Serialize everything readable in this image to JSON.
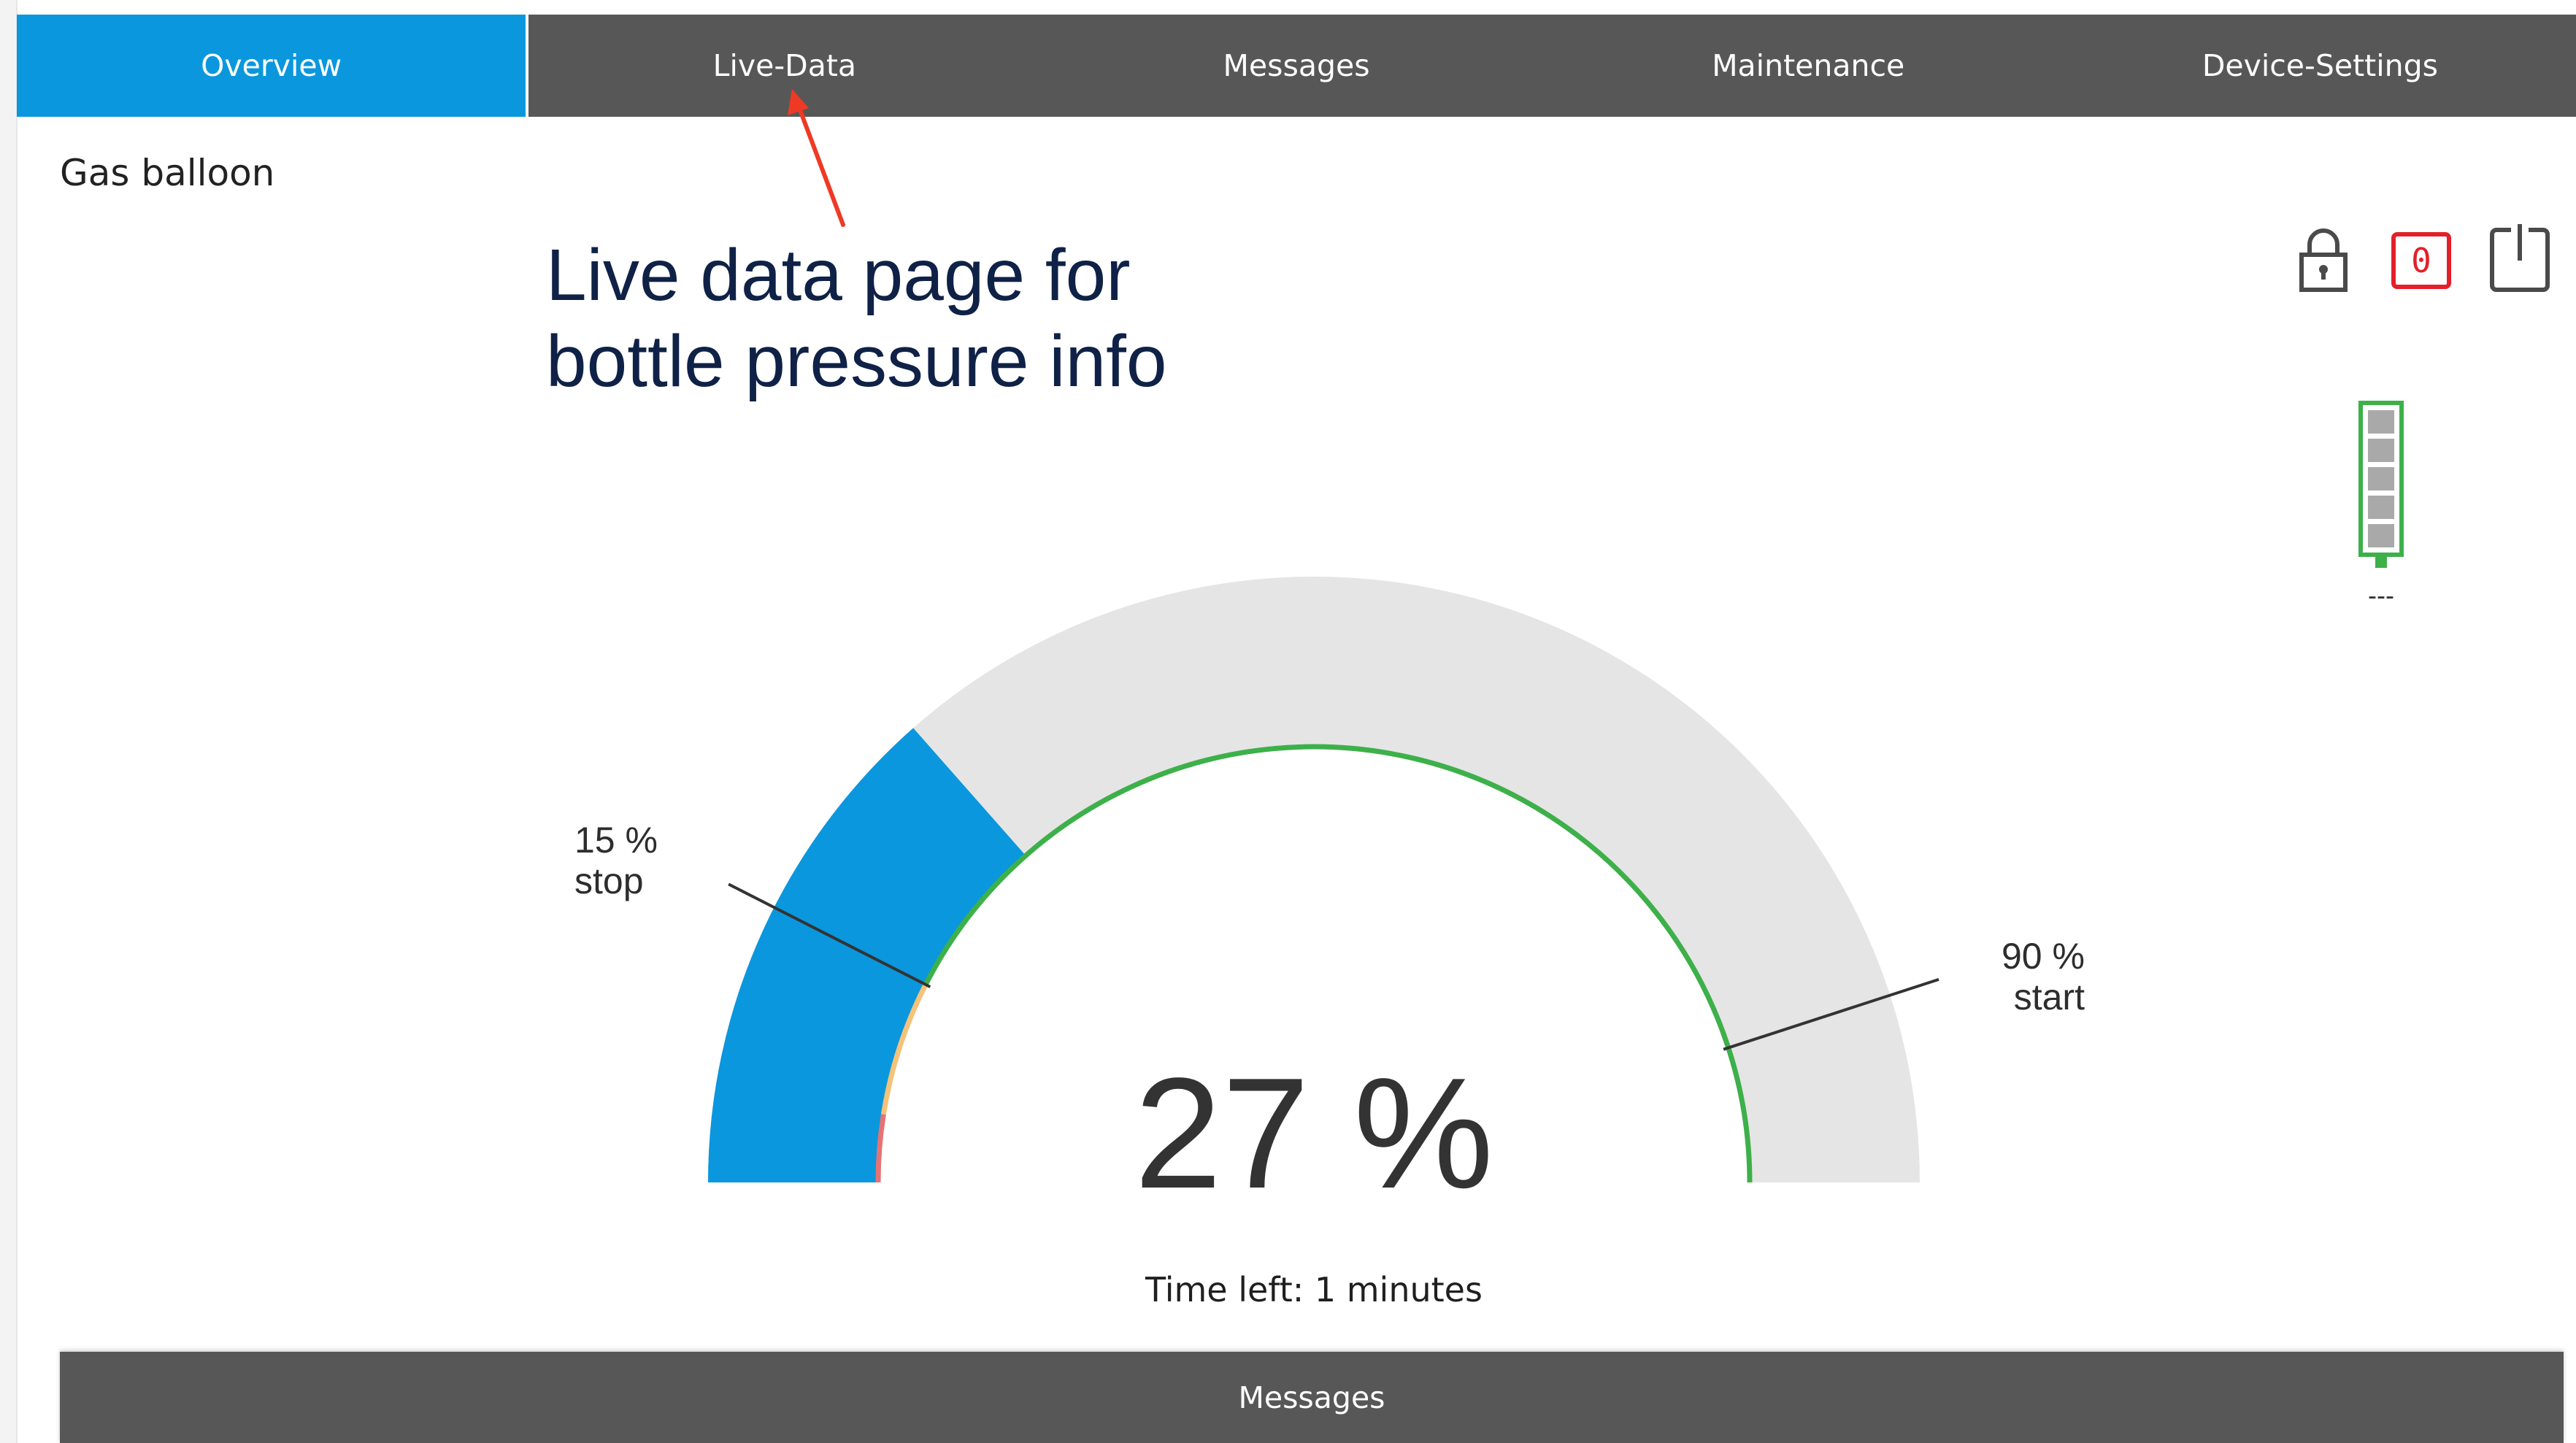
{
  "tabs": [
    {
      "label": "Overview",
      "active": true
    },
    {
      "label": "Live-Data",
      "active": false
    },
    {
      "label": "Messages",
      "active": false
    },
    {
      "label": "Maintenance",
      "active": false
    },
    {
      "label": "Device-Settings",
      "active": false
    }
  ],
  "device": {
    "name": "Gas balloon"
  },
  "annotation": {
    "line1": "Live data page for",
    "line2": "bottle pressure info"
  },
  "status": {
    "lock_icon": "lock-icon",
    "counter_value": "0",
    "power_icon": "power-icon",
    "battery_label": "---",
    "battery_level": 1.0
  },
  "gauge": {
    "value_text": "27 %",
    "value_percent": 27,
    "stop_value": "15 %",
    "stop_label": "stop",
    "start_value": "90 %",
    "start_label": "start",
    "time_left": "Time left: 1 minutes"
  },
  "colors": {
    "accent": "#0a97dd",
    "tab_bg": "#575757",
    "gauge_track": "#e5e5e5",
    "gauge_ring": "#3db04a",
    "alert_red": "#e3202a",
    "annotation": "#0f2146",
    "arrow": "#ee3a24"
  },
  "messages_panel": {
    "label": "Messages"
  }
}
